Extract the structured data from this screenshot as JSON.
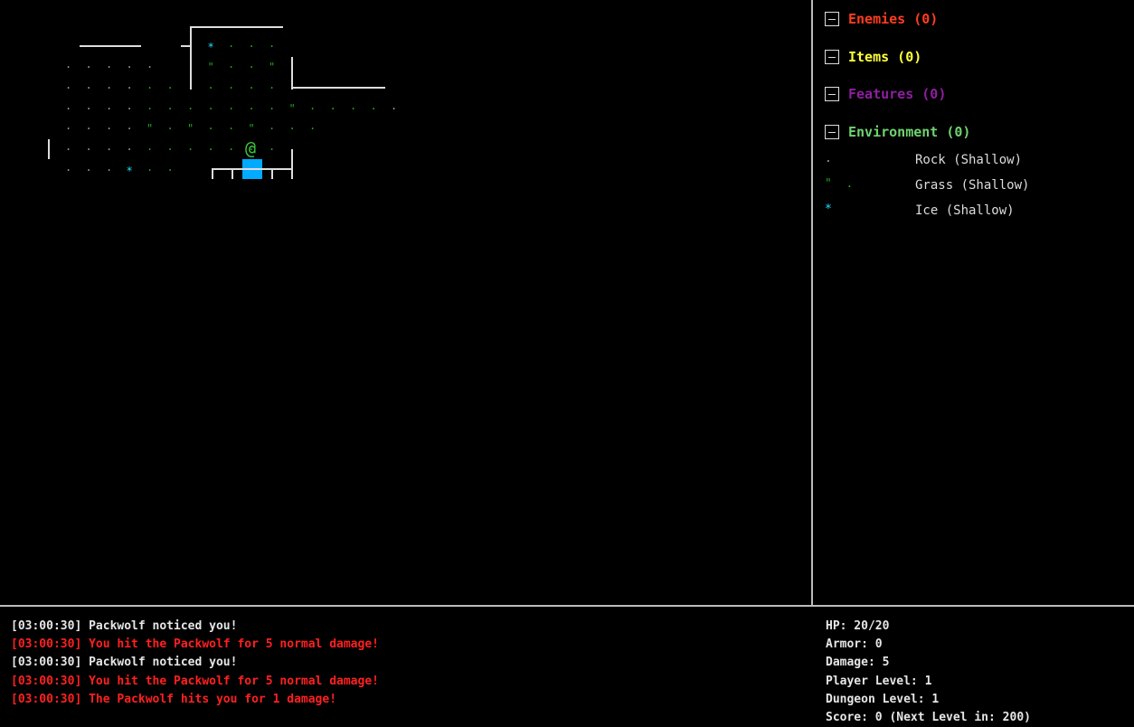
{
  "colors": {
    "enemies": "#ff3d1f",
    "items": "#ffff3a",
    "features": "#8e1fa0",
    "environment": "#6fd36f",
    "rock": "#9a9a9a",
    "grass": "#1fa81f",
    "ice": "#20e0ff",
    "player": "#3cc23c",
    "enemy_block": "#00aaff",
    "log_info": "#e6e6e6",
    "log_combat": "#ff2020"
  },
  "sidebar": {
    "categories": [
      {
        "label": "Enemies (0)",
        "color": "#ff3d1f"
      },
      {
        "label": "Items (0)",
        "color": "#ffff3a"
      },
      {
        "label": "Features (0)",
        "color": "#8e1fa0"
      },
      {
        "label": "Environment (0)",
        "color": "#6fd36f"
      }
    ],
    "environment_entries": [
      {
        "glyph": ".",
        "icon": "rock-icon",
        "name": "Rock (Shallow)"
      },
      {
        "glyph": "\"  .",
        "icon": "grass-icon",
        "name": "Grass (Shallow)"
      },
      {
        "glyph": "*",
        "icon": "ice-icon",
        "name": "Ice (Shallow)"
      }
    ]
  },
  "map": {
    "player_glyph": "@",
    "rock_glyph": ".",
    "grass_glyph": "\"",
    "grass_dot_glyph": ".",
    "ice_glyph": "*"
  },
  "log": [
    {
      "text": "[03:00:30] Packwolf noticed you!",
      "kind": "info"
    },
    {
      "text": "[03:00:30] You hit the Packwolf for 5 normal damage!",
      "kind": "combat"
    },
    {
      "text": "[03:00:30] Packwolf noticed you!",
      "kind": "info"
    },
    {
      "text": "[03:00:30] You hit the Packwolf for 5 normal damage!",
      "kind": "combat"
    },
    {
      "text": "[03:00:30] The Packwolf hits you for 1 damage!",
      "kind": "combat"
    }
  ],
  "stats": {
    "hp": "HP: 20/20",
    "armor": "Armor: 0",
    "damage": "Damage: 5",
    "player_level": "Player Level: 1",
    "dungeon_level": "Dungeon Level: 1",
    "score": "Score: 0 (Next Level in: 200)"
  }
}
